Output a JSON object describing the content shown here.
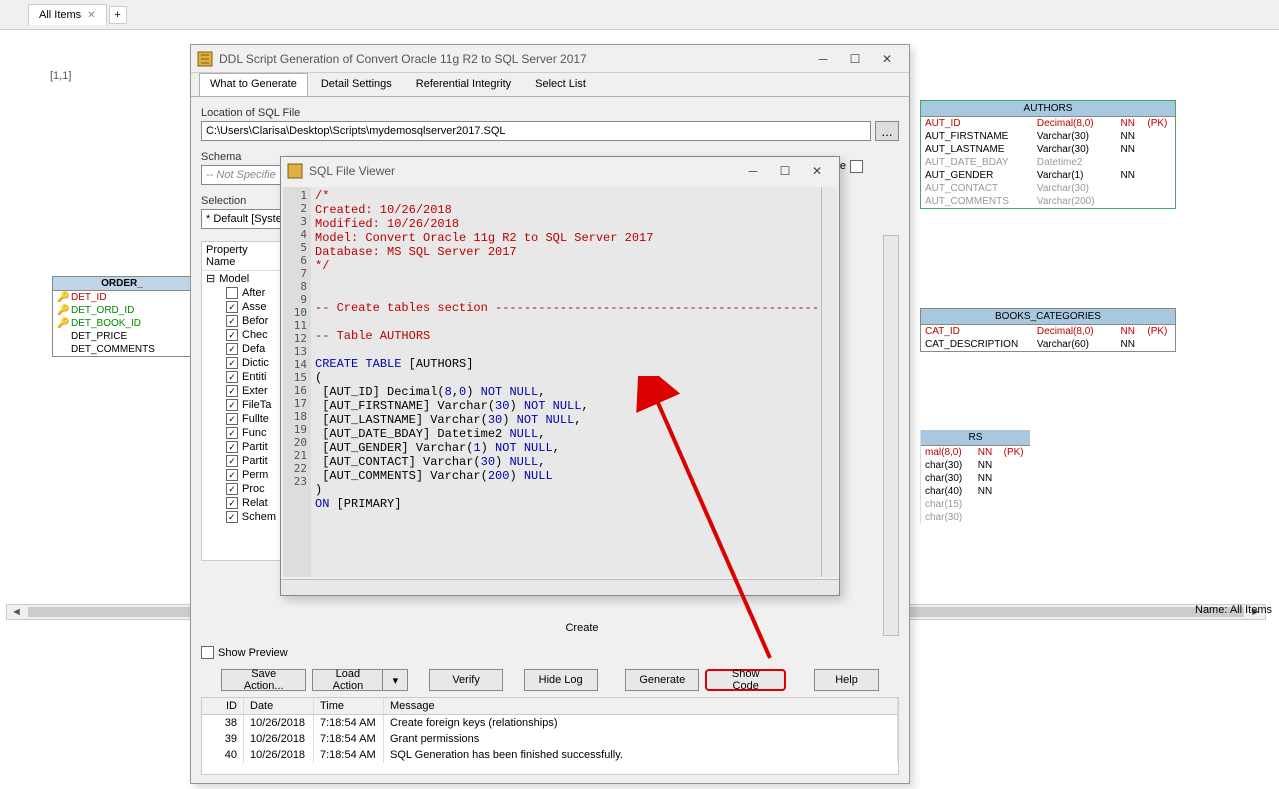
{
  "shell": {
    "tab_name": "All Items",
    "coord": "[1,1]",
    "hscroll_label": "Name: All Items"
  },
  "order_table": {
    "title": "ORDER_",
    "rows": [
      {
        "name": "DET_ID",
        "pk": true
      },
      {
        "name": "DET_ORD_ID",
        "fk": true
      },
      {
        "name": "DET_BOOK_ID",
        "fk": true
      },
      {
        "name": "DET_PRICE"
      },
      {
        "name": "DET_COMMENTS"
      }
    ]
  },
  "authors_table": {
    "title": "AUTHORS",
    "rows": [
      {
        "name": "AUT_ID",
        "type": "Decimal(8,0)",
        "nn": "NN",
        "pk": "(PK)",
        "cls": "pk"
      },
      {
        "name": "AUT_FIRSTNAME",
        "type": "Varchar(30)",
        "nn": "NN",
        "pk": ""
      },
      {
        "name": "AUT_LASTNAME",
        "type": "Varchar(30)",
        "nn": "NN",
        "pk": ""
      },
      {
        "name": "AUT_DATE_BDAY",
        "type": "Datetime2",
        "nn": "",
        "pk": "",
        "cls": "dim"
      },
      {
        "name": "AUT_GENDER",
        "type": "Varchar(1)",
        "nn": "NN",
        "pk": ""
      },
      {
        "name": "AUT_CONTACT",
        "type": "Varchar(30)",
        "nn": "",
        "pk": "",
        "cls": "dim"
      },
      {
        "name": "AUT_COMMENTS",
        "type": "Varchar(200)",
        "nn": "",
        "pk": "",
        "cls": "dim"
      }
    ]
  },
  "books_table": {
    "title": "BOOKS_CATEGORIES",
    "rows": [
      {
        "name": "CAT_ID",
        "type": "Decimal(8,0)",
        "nn": "NN",
        "pk": "(PK)",
        "cls": "pk"
      },
      {
        "name": "CAT_DESCRIPTION",
        "type": "Varchar(60)",
        "nn": "NN",
        "pk": ""
      }
    ]
  },
  "rs_table": {
    "title": "RS",
    "rows": [
      {
        "type": "mal(8,0)",
        "nn": "NN",
        "pk": "(PK)",
        "cls": "pk"
      },
      {
        "type": "char(30)",
        "nn": "NN"
      },
      {
        "type": "char(30)",
        "nn": "NN"
      },
      {
        "type": "char(40)",
        "nn": "NN"
      },
      {
        "type": "char(15)",
        "cls": "dim"
      },
      {
        "type": "char(30)",
        "cls": "dim"
      }
    ]
  },
  "dialog": {
    "title": "DDL Script Generation of Convert Oracle 11g R2 to SQL Server 2017",
    "tabs": [
      "What to Generate",
      "Detail Settings",
      "Referential Integrity",
      "Select List"
    ],
    "location_label": "Location of SQL File",
    "location_value": "C:\\Users\\Clarisa\\Desktop\\Scripts\\mydemosqlserver2017.SQL",
    "schema_label": "Schema",
    "schema_value": "-- Not Specified",
    "selection_label": "Selection",
    "selection_value": "* Default [Syste",
    "file_label": "File",
    "prop_name": "Property Name",
    "model_label": "Model",
    "tree": [
      {
        "label": "After",
        "checked": false
      },
      {
        "label": "Asse",
        "checked": true
      },
      {
        "label": "Befor",
        "checked": true
      },
      {
        "label": "Chec",
        "checked": true
      },
      {
        "label": "Defa",
        "checked": true
      },
      {
        "label": "Dictic",
        "checked": true
      },
      {
        "label": "Entiti",
        "checked": true
      },
      {
        "label": "Exter",
        "checked": true
      },
      {
        "label": "FileTa",
        "checked": true
      },
      {
        "label": "Fullte",
        "checked": true
      },
      {
        "label": "Func",
        "checked": true
      },
      {
        "label": "Partit",
        "checked": true
      },
      {
        "label": "Partit",
        "checked": true
      },
      {
        "label": "Perm",
        "checked": true
      },
      {
        "label": "Proc",
        "checked": true
      },
      {
        "label": "Relat",
        "checked": true
      },
      {
        "label": "Schem",
        "checked": true
      }
    ],
    "create_label": "Create",
    "show_preview": "Show Preview",
    "buttons": {
      "save_action": "Save Action...",
      "load_action": "Load Action",
      "verify": "Verify",
      "hide_log": "Hide Log",
      "generate": "Generate",
      "show_code": "Show Code",
      "help": "Help"
    },
    "log": {
      "headers": [
        "ID",
        "Date",
        "Time",
        "Message"
      ],
      "rows": [
        {
          "id": "38",
          "date": "10/26/2018",
          "time": "7:18:54 AM",
          "msg": "Create foreign keys (relationships)"
        },
        {
          "id": "39",
          "date": "10/26/2018",
          "time": "7:18:54 AM",
          "msg": "Grant permissions"
        },
        {
          "id": "40",
          "date": "10/26/2018",
          "time": "7:18:54 AM",
          "msg": "SQL Generation has been finished successfully."
        }
      ]
    }
  },
  "viewer": {
    "title": "SQL File Viewer",
    "lines": [
      {
        "n": 1,
        "cls": "c-red",
        "t": "/*"
      },
      {
        "n": 2,
        "cls": "c-red",
        "t": "Created: 10/26/2018"
      },
      {
        "n": 3,
        "cls": "c-red",
        "t": "Modified: 10/26/2018"
      },
      {
        "n": 4,
        "cls": "c-red",
        "t": "Model: Convert Oracle 11g R2 to SQL Server 2017"
      },
      {
        "n": 5,
        "cls": "c-red",
        "t": "Database: MS SQL Server 2017"
      },
      {
        "n": 6,
        "cls": "c-red",
        "t": "*/"
      },
      {
        "n": 7,
        "cls": "c-black",
        "t": ""
      },
      {
        "n": 8,
        "cls": "c-black",
        "t": ""
      },
      {
        "n": 9,
        "cls": "c-red",
        "t": "-- Create tables section -------------------------------------------------"
      },
      {
        "n": 10,
        "cls": "c-black",
        "t": ""
      },
      {
        "n": 11,
        "cls": "c-red",
        "t": "-- Table AUTHORS"
      },
      {
        "n": 12,
        "cls": "c-black",
        "t": ""
      },
      {
        "n": 13,
        "cls": "",
        "t": "CREATE TABLE [AUTHORS]",
        "html": "<span class='c-blue'>CREATE</span> <span class='c-blue'>TABLE</span> <span class='c-black'>[AUTHORS]</span>"
      },
      {
        "n": 14,
        "cls": "c-black",
        "t": "("
      },
      {
        "n": 15,
        "cls": "",
        "html": " <span class='c-black'>[AUT_ID] Decimal(</span><span class='c-blue'>8</span><span class='c-black'>,</span><span class='c-blue'>0</span><span class='c-black'>) </span><span class='c-blue'>NOT NULL</span><span class='c-black'>,</span>"
      },
      {
        "n": 16,
        "cls": "",
        "html": " <span class='c-black'>[AUT_FIRSTNAME] Varchar(</span><span class='c-blue'>30</span><span class='c-black'>) </span><span class='c-blue'>NOT NULL</span><span class='c-black'>,</span>"
      },
      {
        "n": 17,
        "cls": "",
        "html": " <span class='c-black'>[AUT_LASTNAME] Varchar(</span><span class='c-blue'>30</span><span class='c-black'>) </span><span class='c-blue'>NOT NULL</span><span class='c-black'>,</span>"
      },
      {
        "n": 18,
        "cls": "",
        "html": " <span class='c-black'>[AUT_DATE_BDAY] Datetime2 </span><span class='c-blue'>NULL</span><span class='c-black'>,</span>"
      },
      {
        "n": 19,
        "cls": "",
        "html": " <span class='c-black'>[AUT_GENDER] Varchar(</span><span class='c-blue'>1</span><span class='c-black'>) </span><span class='c-blue'>NOT NULL</span><span class='c-black'>,</span>"
      },
      {
        "n": 20,
        "cls": "",
        "html": " <span class='c-black'>[AUT_CONTACT] Varchar(</span><span class='c-blue'>30</span><span class='c-black'>) </span><span class='c-blue'>NULL</span><span class='c-black'>,</span>"
      },
      {
        "n": 21,
        "cls": "",
        "html": " <span class='c-black'>[AUT_COMMENTS] Varchar(</span><span class='c-blue'>200</span><span class='c-black'>) </span><span class='c-blue'>NULL</span>"
      },
      {
        "n": 22,
        "cls": "c-black",
        "t": ")"
      },
      {
        "n": 23,
        "cls": "",
        "html": "<span class='c-blue'>ON</span> <span class='c-black'>[PRIMARY]</span>"
      }
    ]
  }
}
